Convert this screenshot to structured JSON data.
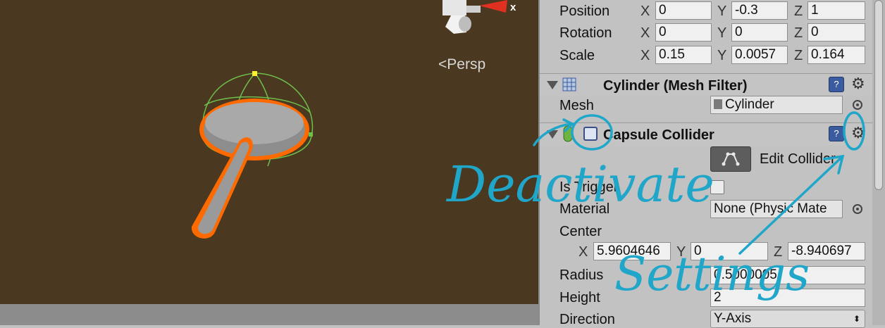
{
  "scene": {
    "persp_label": "Persp",
    "gizmo_axis_label": "x",
    "background": "#4a3820",
    "selection_outline": "#ff6a00",
    "collider_wire": "#6ec04a"
  },
  "transform": {
    "position": {
      "label": "Position",
      "x_axis": "X",
      "y_axis": "Y",
      "z_axis": "Z",
      "x": "0",
      "y": "-0.3",
      "z": "1"
    },
    "rotation": {
      "label": "Rotation",
      "x_axis": "X",
      "y_axis": "Y",
      "z_axis": "Z",
      "x": "0",
      "y": "0",
      "z": "0"
    },
    "scale": {
      "label": "Scale",
      "x_axis": "X",
      "y_axis": "Y",
      "z_axis": "Z",
      "x": "0.15",
      "y": "0.0057",
      "z": "0.164"
    }
  },
  "mesh_filter": {
    "title": "Cylinder (Mesh Filter)",
    "mesh_label": "Mesh",
    "mesh_value": "Cylinder",
    "help_icon": "help-book-icon",
    "settings_icon": "gear-icon"
  },
  "capsule_collider": {
    "title": "Capsule Collider",
    "edit_collider_label": "Edit Collider",
    "is_trigger_label": "Is Trigger",
    "material_label": "Material",
    "material_value": "None (Physic Mate",
    "center_label": "Center",
    "center": {
      "x_axis": "X",
      "y_axis": "Y",
      "z_axis": "Z",
      "x": "5.9604646",
      "y": "0",
      "z": "-8.940697"
    },
    "radius_label": "Radius",
    "radius_value": "0.5000005",
    "height_label": "Height",
    "height_value": "2",
    "direction_label": "Direction",
    "direction_value": "Y-Axis",
    "enabled": true,
    "is_trigger": false
  },
  "annotations": {
    "deactivate": "Deactivate",
    "settings": "Settings",
    "color": "#1fa6c9"
  }
}
